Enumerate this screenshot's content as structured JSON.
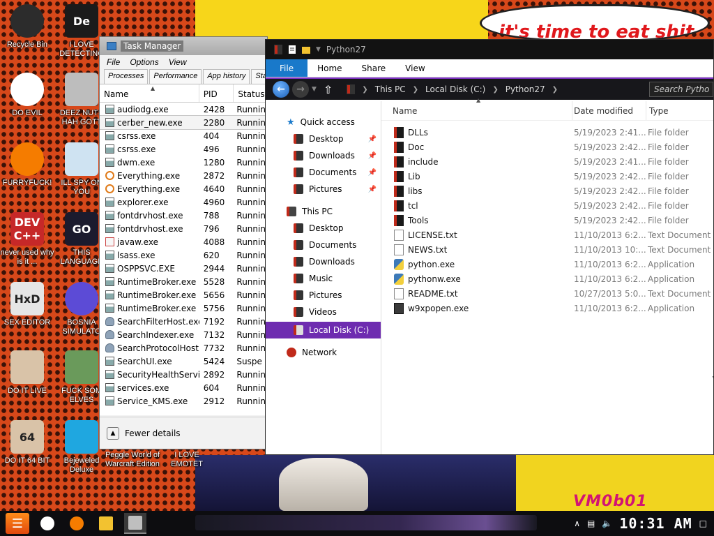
{
  "desktop": {
    "speech_text": "it's time to eat shit",
    "watermark": "VM0b01",
    "icons": [
      {
        "label": "Recycle Bin",
        "glyph": "",
        "color": "#2c2c2c",
        "icon": "recycle-bin-icon"
      },
      {
        "label": "I LOVE DETECTING",
        "glyph": "De",
        "color": "#1b1b1b",
        "icon": "detect-it-easy-icon"
      },
      {
        "label": "DO EVIL",
        "glyph": "",
        "color": "#ffffff",
        "icon": "chrome-icon"
      },
      {
        "label": "DEEZ NUTS HAH GOTT",
        "glyph": "",
        "color": "#bdbdbd",
        "icon": "shortcut-stack-icon"
      },
      {
        "label": "FURRYFUCK!",
        "glyph": "",
        "color": "#f57c00",
        "icon": "firefox-icon"
      },
      {
        "label": "ILL SPY ON YOU",
        "glyph": "",
        "color": "#cfe3f2",
        "icon": "search-spy-icon"
      },
      {
        "label": "never used why is it ...",
        "glyph": "DEV C++",
        "color": "#c62828",
        "icon": "dev-cpp-icon"
      },
      {
        "label": "THIS LANGUAGE",
        "glyph": "GO",
        "color": "#1b1b2e",
        "icon": "go-lang-icon"
      },
      {
        "label": "SEX EDITOR",
        "glyph": "HxD",
        "color": "#e6e6e6",
        "icon": "hxd-icon"
      },
      {
        "label": "BOSNIA SIMULATO",
        "glyph": "",
        "color": "#5c4bd6",
        "icon": "minesweeper-icon"
      },
      {
        "label": "DO IT LIVE",
        "glyph": "",
        "color": "#d9c3a8",
        "icon": "portrait-icon"
      },
      {
        "label": "FUCK SOM ELVES",
        "glyph": "",
        "color": "#6a9a5b",
        "icon": "elf-icon"
      },
      {
        "label": "DO IT 64 BIT",
        "glyph": "64",
        "color": "#d9c3a8",
        "icon": "portrait-64-icon"
      },
      {
        "label": "Bejeweled Deluxe",
        "glyph": "",
        "color": "#1fa7e0",
        "icon": "bejeweled-icon"
      },
      {
        "label": "Peggle World of Warcraft Edition",
        "glyph": "",
        "color": "#333333",
        "icon": "peggle-icon"
      },
      {
        "label": "I LOVE EMOTET",
        "glyph": "",
        "color": "#333333",
        "icon": "emotet-icon"
      }
    ]
  },
  "task_manager": {
    "title": "Task Manager",
    "menu": [
      "File",
      "Options",
      "View"
    ],
    "tabs": [
      "Processes",
      "Performance",
      "App history",
      "Star"
    ],
    "columns": {
      "name": "Name",
      "pid": "PID",
      "status": "Status"
    },
    "processes": [
      {
        "name": "audiodg.exe",
        "pid": "2428",
        "status": "Runnin",
        "icon": "app"
      },
      {
        "name": "cerber_new.exe",
        "pid": "2280",
        "status": "Runnin",
        "icon": "app"
      },
      {
        "name": "csrss.exe",
        "pid": "404",
        "status": "Runnin",
        "icon": "app"
      },
      {
        "name": "csrss.exe",
        "pid": "496",
        "status": "Runnin",
        "icon": "app"
      },
      {
        "name": "dwm.exe",
        "pid": "1280",
        "status": "Runnin",
        "icon": "app"
      },
      {
        "name": "Everything.exe",
        "pid": "2872",
        "status": "Runnin",
        "icon": "every"
      },
      {
        "name": "Everything.exe",
        "pid": "4640",
        "status": "Runnin",
        "icon": "every"
      },
      {
        "name": "explorer.exe",
        "pid": "4960",
        "status": "Runnin",
        "icon": "app"
      },
      {
        "name": "fontdrvhost.exe",
        "pid": "788",
        "status": "Runnin",
        "icon": "app"
      },
      {
        "name": "fontdrvhost.exe",
        "pid": "796",
        "status": "Runnin",
        "icon": "app"
      },
      {
        "name": "javaw.exe",
        "pid": "4088",
        "status": "Runnin",
        "icon": "java"
      },
      {
        "name": "lsass.exe",
        "pid": "620",
        "status": "Runnin",
        "icon": "app"
      },
      {
        "name": "OSPPSVC.EXE",
        "pid": "2944",
        "status": "Runnin",
        "icon": "app"
      },
      {
        "name": "RuntimeBroker.exe",
        "pid": "5528",
        "status": "Runnin",
        "icon": "app"
      },
      {
        "name": "RuntimeBroker.exe",
        "pid": "5656",
        "status": "Runnin",
        "icon": "app"
      },
      {
        "name": "RuntimeBroker.exe",
        "pid": "5756",
        "status": "Runnin",
        "icon": "app"
      },
      {
        "name": "SearchFilterHost.exe",
        "pid": "7192",
        "status": "Runnin",
        "icon": "user"
      },
      {
        "name": "SearchIndexer.exe",
        "pid": "7132",
        "status": "Runnin",
        "icon": "user"
      },
      {
        "name": "SearchProtocolHost....",
        "pid": "7732",
        "status": "Runnin",
        "icon": "user"
      },
      {
        "name": "SearchUI.exe",
        "pid": "5424",
        "status": "Suspe",
        "icon": "app"
      },
      {
        "name": "SecurityHealthServi...",
        "pid": "2892",
        "status": "Runnin",
        "icon": "app"
      },
      {
        "name": "services.exe",
        "pid": "604",
        "status": "Runnin",
        "icon": "app"
      },
      {
        "name": "Service_KMS.exe",
        "pid": "2912",
        "status": "Runnin",
        "icon": "app"
      }
    ],
    "fewer_details": "Fewer details"
  },
  "explorer": {
    "title": "Python27",
    "ribbon": [
      "File",
      "Home",
      "Share",
      "View"
    ],
    "breadcrumb": [
      "This PC",
      "Local Disk (C:)",
      "Python27"
    ],
    "search_placeholder": "Search Pytho",
    "nav": {
      "quick_access": "Quick access",
      "quick_items": [
        "Desktop",
        "Downloads",
        "Documents",
        "Pictures"
      ],
      "this_pc": "This PC",
      "pc_items": [
        "Desktop",
        "Documents",
        "Downloads",
        "Music",
        "Pictures",
        "Videos"
      ],
      "local_disk": "Local Disk (C:)",
      "network": "Network"
    },
    "columns": {
      "name": "Name",
      "date": "Date modified",
      "type": "Type"
    },
    "files": [
      {
        "name": "DLLs",
        "date": "5/19/2023 2:41...",
        "type": "File folder",
        "icon": "folder"
      },
      {
        "name": "Doc",
        "date": "5/19/2023 2:42...",
        "type": "File folder",
        "icon": "folder"
      },
      {
        "name": "include",
        "date": "5/19/2023 2:41...",
        "type": "File folder",
        "icon": "folder"
      },
      {
        "name": "Lib",
        "date": "5/19/2023 2:42...",
        "type": "File folder",
        "icon": "folder"
      },
      {
        "name": "libs",
        "date": "5/19/2023 2:42...",
        "type": "File folder",
        "icon": "folder"
      },
      {
        "name": "tcl",
        "date": "5/19/2023 2:42...",
        "type": "File folder",
        "icon": "folder"
      },
      {
        "name": "Tools",
        "date": "5/19/2023 2:42...",
        "type": "File folder",
        "icon": "folder"
      },
      {
        "name": "LICENSE.txt",
        "date": "11/10/2013 6:2...",
        "type": "Text Document",
        "icon": "text"
      },
      {
        "name": "NEWS.txt",
        "date": "11/10/2013 10:...",
        "type": "Text Document",
        "icon": "text"
      },
      {
        "name": "python.exe",
        "date": "11/10/2013 6:2...",
        "type": "Application",
        "icon": "py"
      },
      {
        "name": "pythonw.exe",
        "date": "11/10/2013 6:2...",
        "type": "Application",
        "icon": "py"
      },
      {
        "name": "README.txt",
        "date": "10/27/2013 5:0...",
        "type": "Text Document",
        "icon": "text"
      },
      {
        "name": "w9xpopen.exe",
        "date": "11/10/2013 6:2...",
        "type": "Application",
        "icon": "app"
      }
    ]
  },
  "taskbar": {
    "start_glyph": "☰",
    "apps": [
      {
        "icon": "chrome-icon",
        "color": "#ffffff",
        "active": false
      },
      {
        "icon": "firefox-icon",
        "color": "#f57c00",
        "active": false
      },
      {
        "icon": "file-explorer-icon",
        "color": "#f2c230",
        "active": false
      },
      {
        "icon": "task-manager-icon",
        "color": "#bfbfbf",
        "active": true
      }
    ],
    "tray_arrow": "∧",
    "clock": "10:31 AM"
  }
}
